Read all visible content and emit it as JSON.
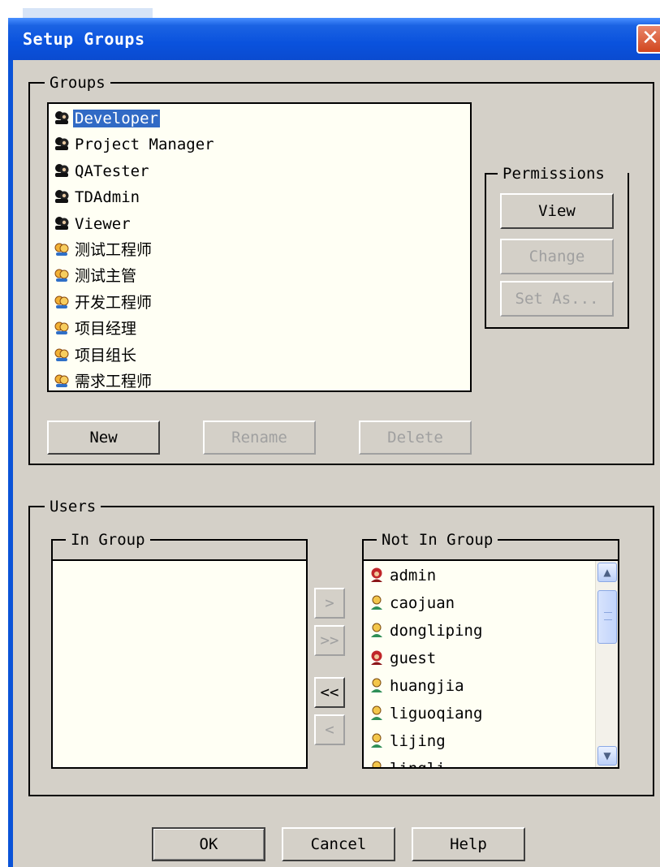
{
  "dialog": {
    "title": "Setup Groups"
  },
  "groups": {
    "legend": "Groups",
    "items": [
      {
        "label": "Developer",
        "icon": "group-icon",
        "selected": true
      },
      {
        "label": "Project Manager",
        "icon": "group-icon"
      },
      {
        "label": "QATester",
        "icon": "group-icon"
      },
      {
        "label": "TDAdmin",
        "icon": "group-icon"
      },
      {
        "label": "Viewer",
        "icon": "group-icon"
      },
      {
        "label": "测试工程师",
        "icon": "custom-group-icon"
      },
      {
        "label": "测试主管",
        "icon": "custom-group-icon"
      },
      {
        "label": "开发工程师",
        "icon": "custom-group-icon"
      },
      {
        "label": "项目经理",
        "icon": "custom-group-icon"
      },
      {
        "label": "项目组长",
        "icon": "custom-group-icon"
      },
      {
        "label": "需求工程师",
        "icon": "custom-group-icon"
      }
    ],
    "buttons": {
      "new": "New",
      "rename": "Rename",
      "delete": "Delete"
    }
  },
  "permissions": {
    "legend": "Permissions",
    "buttons": {
      "view": "View",
      "change": "Change",
      "set_as": "Set As..."
    }
  },
  "users": {
    "legend": "Users",
    "in_group": {
      "legend": "In Group",
      "items": []
    },
    "not_in_group": {
      "legend": "Not In Group",
      "items": [
        {
          "label": "admin",
          "icon": "admin-user-icon"
        },
        {
          "label": "caojuan",
          "icon": "user-icon"
        },
        {
          "label": "dongliping",
          "icon": "user-icon"
        },
        {
          "label": "guest",
          "icon": "admin-user-icon"
        },
        {
          "label": "huangjia",
          "icon": "user-icon"
        },
        {
          "label": "liguoqiang",
          "icon": "user-icon"
        },
        {
          "label": "lijing",
          "icon": "user-icon"
        },
        {
          "label": "lingli",
          "icon": "user-icon"
        }
      ]
    },
    "transfer": {
      "add": ">",
      "add_all": ">>",
      "remove_all": "<<",
      "remove": "<"
    }
  },
  "footer": {
    "ok": "OK",
    "cancel": "Cancel",
    "help": "Help"
  },
  "colors": {
    "title_bar": "#0a52dd",
    "selection": "#316ac5",
    "dialog_bg": "#d4d0c8",
    "list_bg": "#fffff4",
    "close_button": "#d1461e"
  }
}
